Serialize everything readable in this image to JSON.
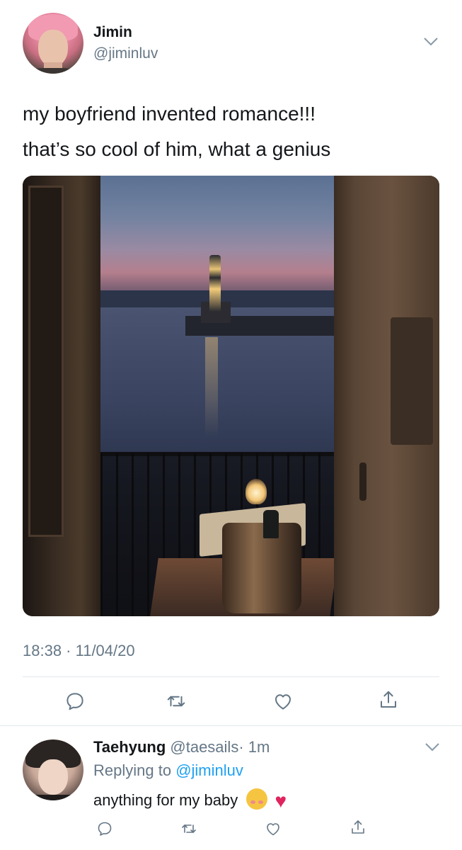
{
  "tweet": {
    "name": "Jimin",
    "handle": "@jiminluv",
    "text_line1": "my boyfriend invented romance!!!",
    "text_line2": "that’s so cool of him, what a genius",
    "timestamp": "18:38 · 11/04/20"
  },
  "actions": {
    "reply_icon": "reply-icon",
    "retweet_icon": "retweet-icon",
    "like_icon": "heart-icon",
    "share_icon": "share-icon"
  },
  "reply": {
    "name": "Taehyung",
    "handle": "@taesails",
    "time": "· 1m",
    "replying_prefix": "Replying to",
    "replying_handle": "@jiminluv",
    "text": "anything for my baby",
    "emojis": [
      "smiling-face-with-hearts",
      "red-heart"
    ]
  },
  "colors": {
    "link": "#1da1f2",
    "secondary_text": "#657786",
    "icon": "#657786"
  }
}
